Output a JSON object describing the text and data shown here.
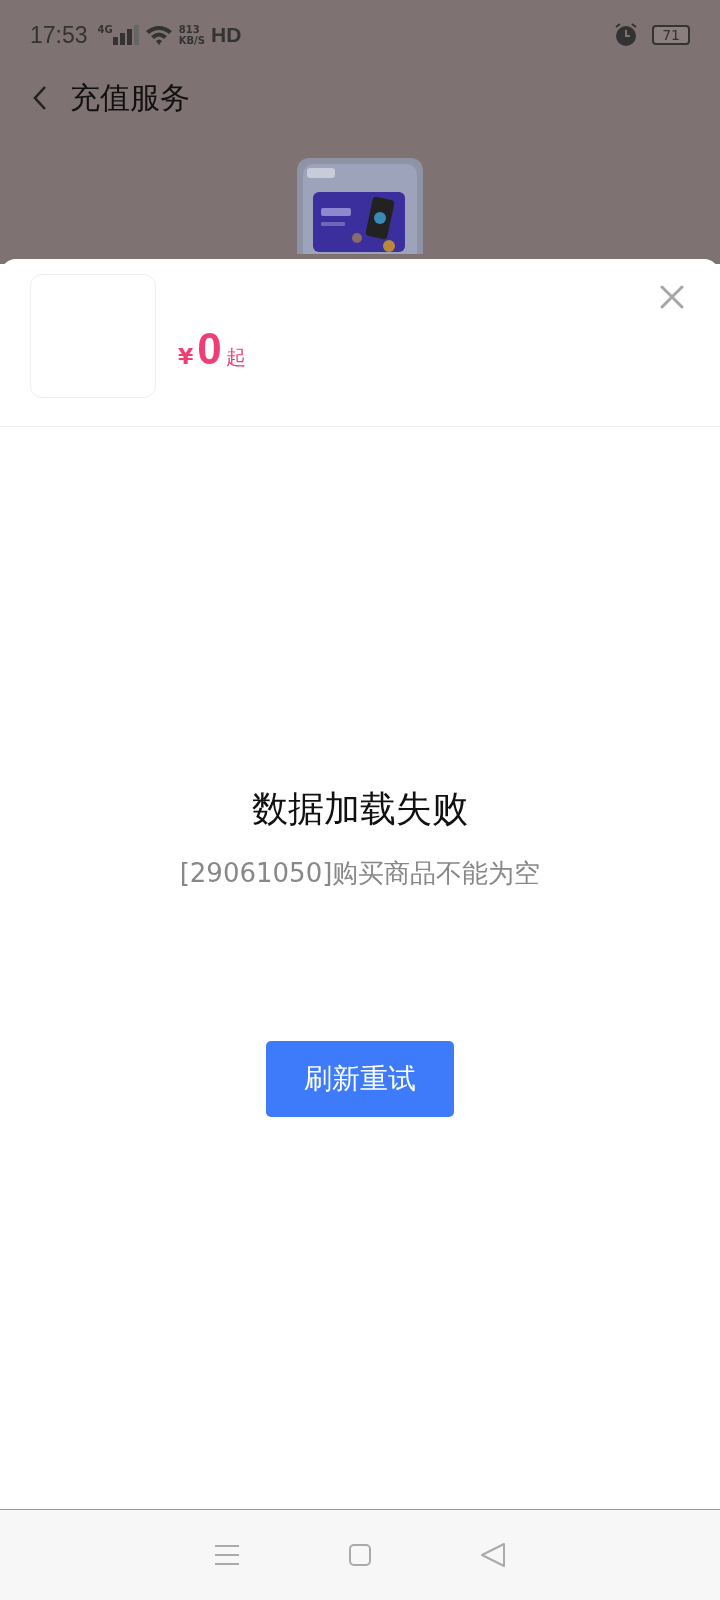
{
  "status_bar": {
    "time": "17:53",
    "network": "4G",
    "speed_value": "813",
    "speed_unit": "KB/S",
    "hd": "HD",
    "battery": "71"
  },
  "header": {
    "title": "充值服务"
  },
  "sheet": {
    "currency": "¥",
    "price": "0",
    "price_suffix": "起",
    "error_title": "数据加载失败",
    "error_message": "[29061050]购买商品不能为空",
    "retry_button": "刷新重试"
  }
}
